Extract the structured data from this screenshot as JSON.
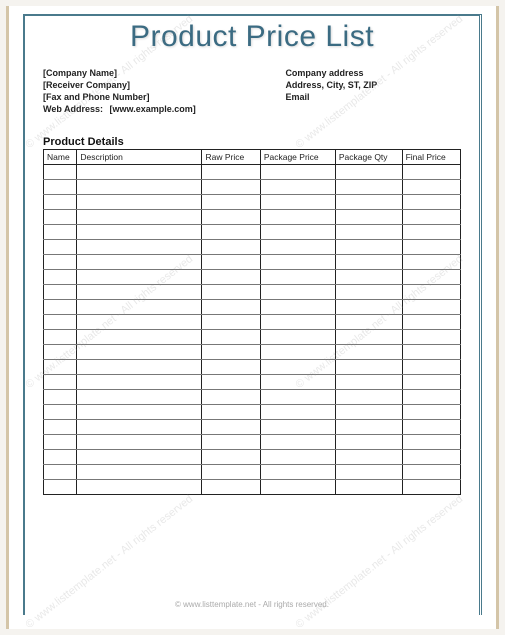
{
  "title": "Product Price List",
  "info": {
    "company_name": "[Company Name]",
    "receiver_company": "[Receiver Company]",
    "fax_phone": "[Fax and Phone Number]",
    "web_label": "Web Address:",
    "web_value": "[www.example.com]",
    "company_address": "Company address",
    "address_line": "Address, City, ST, ZIP",
    "email": "Email"
  },
  "section_title": "Product Details",
  "columns": {
    "name": "Name",
    "description": "Description",
    "raw_price": "Raw Price",
    "package_price": "Package Price",
    "package_qty": "Package Qty",
    "final_price": "Final Price"
  },
  "rows": [
    {
      "name": "",
      "description": "",
      "raw_price": "",
      "package_price": "",
      "package_qty": "",
      "final_price": ""
    },
    {
      "name": "",
      "description": "",
      "raw_price": "",
      "package_price": "",
      "package_qty": "",
      "final_price": ""
    },
    {
      "name": "",
      "description": "",
      "raw_price": "",
      "package_price": "",
      "package_qty": "",
      "final_price": ""
    },
    {
      "name": "",
      "description": "",
      "raw_price": "",
      "package_price": "",
      "package_qty": "",
      "final_price": ""
    },
    {
      "name": "",
      "description": "",
      "raw_price": "",
      "package_price": "",
      "package_qty": "",
      "final_price": ""
    },
    {
      "name": "",
      "description": "",
      "raw_price": "",
      "package_price": "",
      "package_qty": "",
      "final_price": ""
    },
    {
      "name": "",
      "description": "",
      "raw_price": "",
      "package_price": "",
      "package_qty": "",
      "final_price": ""
    },
    {
      "name": "",
      "description": "",
      "raw_price": "",
      "package_price": "",
      "package_qty": "",
      "final_price": ""
    },
    {
      "name": "",
      "description": "",
      "raw_price": "",
      "package_price": "",
      "package_qty": "",
      "final_price": ""
    },
    {
      "name": "",
      "description": "",
      "raw_price": "",
      "package_price": "",
      "package_qty": "",
      "final_price": ""
    },
    {
      "name": "",
      "description": "",
      "raw_price": "",
      "package_price": "",
      "package_qty": "",
      "final_price": ""
    },
    {
      "name": "",
      "description": "",
      "raw_price": "",
      "package_price": "",
      "package_qty": "",
      "final_price": ""
    },
    {
      "name": "",
      "description": "",
      "raw_price": "",
      "package_price": "",
      "package_qty": "",
      "final_price": ""
    },
    {
      "name": "",
      "description": "",
      "raw_price": "",
      "package_price": "",
      "package_qty": "",
      "final_price": ""
    },
    {
      "name": "",
      "description": "",
      "raw_price": "",
      "package_price": "",
      "package_qty": "",
      "final_price": ""
    },
    {
      "name": "",
      "description": "",
      "raw_price": "",
      "package_price": "",
      "package_qty": "",
      "final_price": ""
    },
    {
      "name": "",
      "description": "",
      "raw_price": "",
      "package_price": "",
      "package_qty": "",
      "final_price": ""
    },
    {
      "name": "",
      "description": "",
      "raw_price": "",
      "package_price": "",
      "package_qty": "",
      "final_price": ""
    },
    {
      "name": "",
      "description": "",
      "raw_price": "",
      "package_price": "",
      "package_qty": "",
      "final_price": ""
    },
    {
      "name": "",
      "description": "",
      "raw_price": "",
      "package_price": "",
      "package_qty": "",
      "final_price": ""
    },
    {
      "name": "",
      "description": "",
      "raw_price": "",
      "package_price": "",
      "package_qty": "",
      "final_price": ""
    },
    {
      "name": "",
      "description": "",
      "raw_price": "",
      "package_price": "",
      "package_qty": "",
      "final_price": ""
    }
  ],
  "footer": "© www.listtemplate.net - All rights reserved.",
  "watermark": "© www.listtemplate.net - All rights reserved"
}
